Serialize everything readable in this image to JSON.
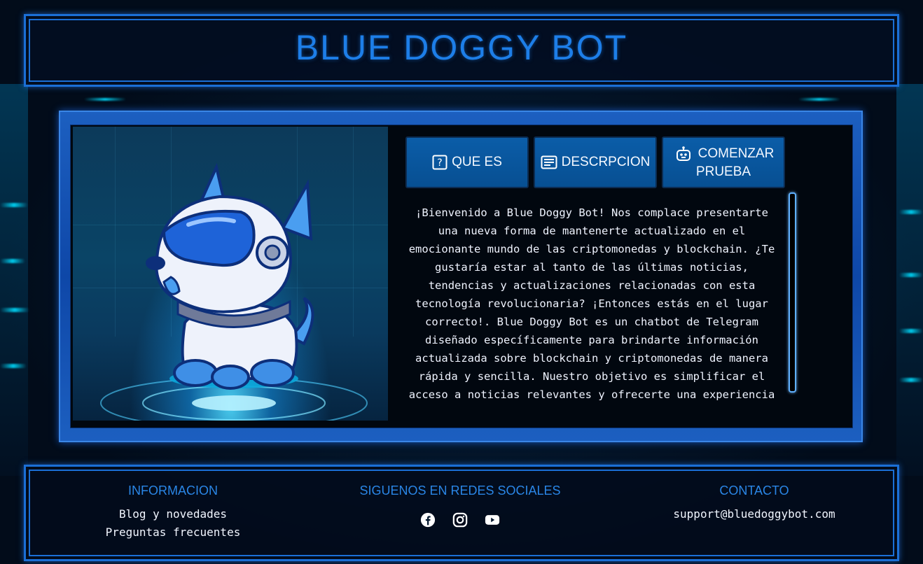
{
  "header": {
    "title": "BLUE DOGGY BOT"
  },
  "tabs": [
    {
      "label": "QUE ES",
      "icon": "question-icon"
    },
    {
      "label": "DESCRPCION",
      "icon": "document-icon"
    },
    {
      "label": "COMENZAR PRUEBA",
      "icon": "robot-icon"
    }
  ],
  "content": {
    "text": "¡Bienvenido a Blue Doggy Bot! Nos complace presentarte una nueva forma de mantenerte actualizado en el emocionante mundo de las criptomonedas y blockchain. ¿Te gustaría estar al tanto de las últimas noticias, tendencias y actualizaciones relacionadas con esta tecnología revolucionaria? ¡Entonces estás en el lugar correcto!. Blue Doggy Bot es un chatbot de Telegram diseñado específicamente para brindarte información actualizada sobre blockchain y criptomonedas de manera rápida y sencilla. Nuestro objetivo es simplificar el acceso a noticias relevantes y ofrecerte una experiencia"
  },
  "footer": {
    "info": {
      "heading": "INFORMACION",
      "links": [
        "Blog y novedades",
        "Preguntas frecuentes"
      ]
    },
    "social": {
      "heading": "SIGUENOS EN REDES SOCIALES",
      "icons": [
        "facebook-icon",
        "instagram-icon",
        "youtube-icon"
      ]
    },
    "contact": {
      "heading": "CONTACTO",
      "email": "support@bluedoggybot.com"
    }
  },
  "colors": {
    "accent": "#1d7ee8",
    "tab_bg": "#0b5da8",
    "frame": "#1b6fd6"
  }
}
